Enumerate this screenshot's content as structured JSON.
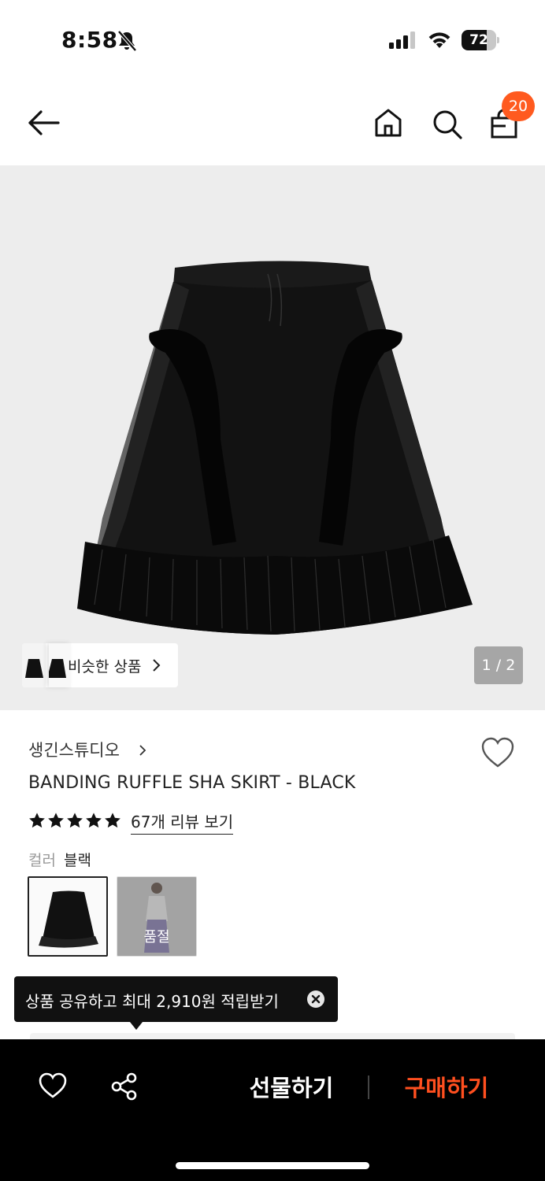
{
  "status_bar": {
    "time": "8:58",
    "battery_level": 72,
    "battery_label": "72",
    "icons": [
      "bell-slash-icon",
      "cellular-signal-icon",
      "wifi-icon",
      "battery-icon"
    ]
  },
  "header": {
    "icons": [
      "back-arrow-icon",
      "home-icon",
      "search-icon",
      "shopping-bag-icon"
    ],
    "cart_count": "20",
    "badge_color": "#ff5a1f"
  },
  "gallery": {
    "background": "#ededed",
    "similar_label": "비슷한 상품",
    "page_indicator": "1 / 2"
  },
  "product": {
    "brand": "생긴스튜디오",
    "title": "BANDING RUFFLE SHA SKIRT - BLACK",
    "rating_stars": 5,
    "review_link": "67개 리뷰 보기",
    "color_label": "컬러",
    "color_value": "블랙",
    "swatches": [
      {
        "selected": true,
        "soldout": false
      },
      {
        "selected": false,
        "soldout": true,
        "badge": "품절"
      }
    ]
  },
  "tooltip": {
    "text": "상품 공유하고 최대 2,910원 적립받기"
  },
  "bottom_bar": {
    "gift_label": "선물하기",
    "buy_label": "구매하기",
    "buy_color": "#ff4f1f"
  }
}
